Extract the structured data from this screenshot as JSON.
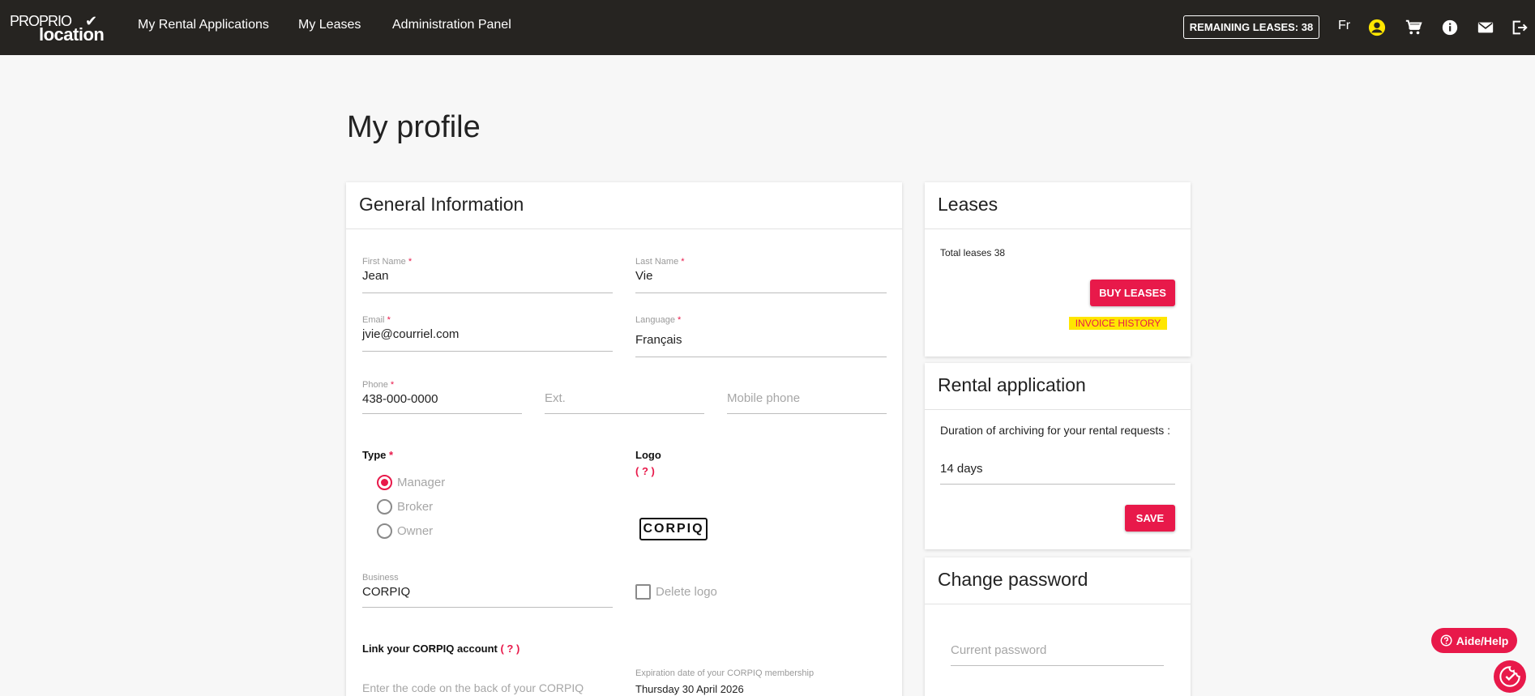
{
  "brand": {
    "line1": "PROPRIO",
    "line2": "location"
  },
  "nav": {
    "items": [
      "My Rental Applications",
      "My Leases",
      "Administration Panel"
    ],
    "remaining": "REMAINING LEASES: 38",
    "lang": "Fr"
  },
  "icons": [
    "account-icon",
    "cart-icon",
    "info-icon",
    "mail-icon",
    "logout-icon"
  ],
  "page": {
    "title": "My profile"
  },
  "general": {
    "title": "General Information",
    "first_name": {
      "label": "First Name",
      "value": "Jean"
    },
    "last_name": {
      "label": "Last Name",
      "value": "Vie"
    },
    "email": {
      "label": "Email",
      "value": "jvie@courriel.com"
    },
    "language": {
      "label": "Language",
      "value": "Français"
    },
    "phone": {
      "label": "Phone",
      "value": "438-000-0000"
    },
    "ext": {
      "placeholder": "Ext."
    },
    "mobile": {
      "placeholder": "Mobile phone"
    },
    "type": {
      "label": "Type",
      "options": [
        "Manager",
        "Broker",
        "Owner"
      ],
      "selected": "Manager"
    },
    "logo": {
      "label": "Logo",
      "help": "( ? )",
      "image_text": "CORPIQ"
    },
    "business": {
      "label": "Business",
      "value": "CORPIQ"
    },
    "delete_logo": "Delete logo",
    "link": {
      "label": "Link your CORPIQ account",
      "help": "( ? )"
    },
    "code": {
      "placeholder": "Enter the code on the back of your CORPIQ"
    },
    "expiration": {
      "label": "Expiration date of your CORPIQ membership",
      "value": "Thursday 30 April 2026"
    },
    "required_mark": "*"
  },
  "leases": {
    "title": "Leases",
    "total": "Total leases 38",
    "buy": "BUY LEASES",
    "invoice": "INVOICE HISTORY"
  },
  "rental": {
    "title": "Rental application",
    "label": "Duration of archiving for your rental requests :",
    "value": "14 days",
    "save": "SAVE"
  },
  "password": {
    "title": "Change password",
    "current": "Current password"
  },
  "help": {
    "label": "Aide/Help"
  },
  "colors": {
    "accent": "#e8194a",
    "nav": "#262421",
    "highlight": "#ffe600"
  }
}
